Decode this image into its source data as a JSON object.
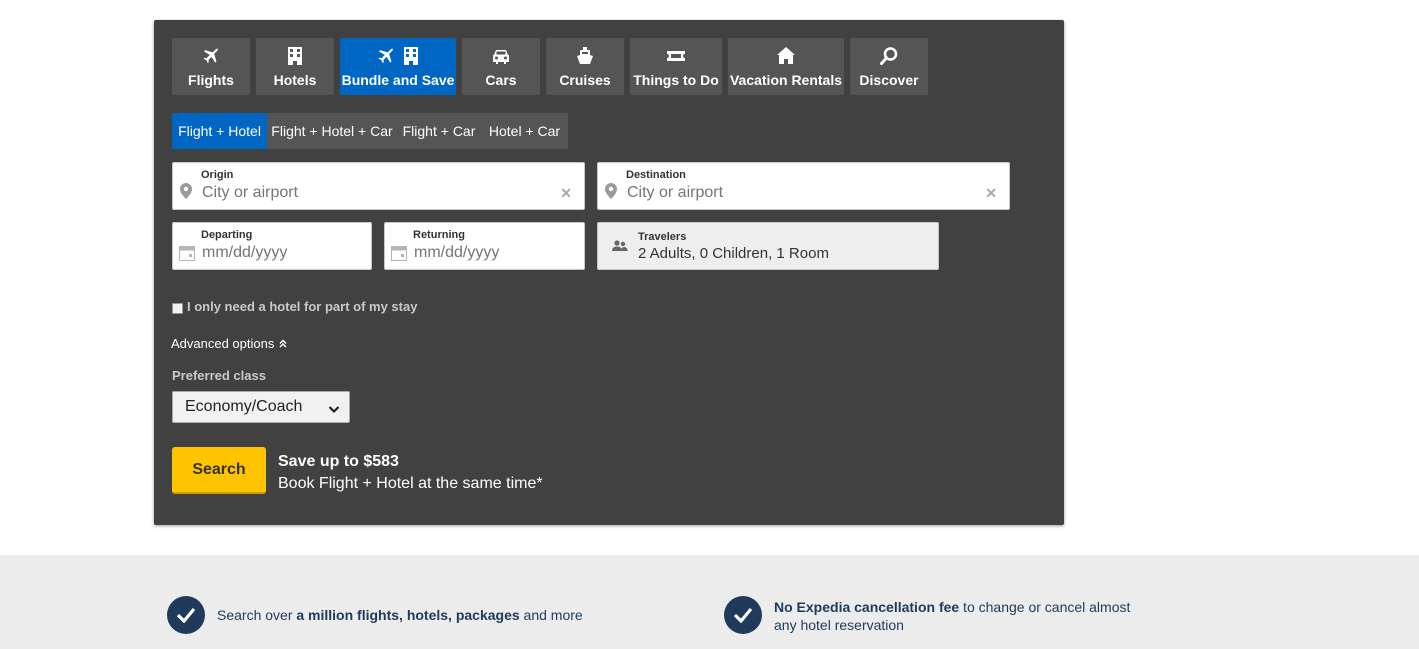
{
  "tabs": [
    {
      "label": "Flights",
      "icon": "plane-icon"
    },
    {
      "label": "Hotels",
      "icon": "building-icon"
    },
    {
      "label": "Bundle and Save",
      "icon": "plane-building-icon"
    },
    {
      "label": "Cars",
      "icon": "car-icon"
    },
    {
      "label": "Cruises",
      "icon": "ship-icon"
    },
    {
      "label": "Things to Do",
      "icon": "ticket-icon"
    },
    {
      "label": "Vacation Rentals",
      "icon": "house-icon"
    },
    {
      "label": "Discover",
      "icon": "magnifier-icon"
    }
  ],
  "active_tab": "Bundle and Save",
  "subtabs": [
    "Flight + Hotel",
    "Flight + Hotel + Car",
    "Flight + Car",
    "Hotel + Car"
  ],
  "active_subtab": "Flight + Hotel",
  "origin": {
    "label": "Origin",
    "placeholder": "City or airport"
  },
  "destination": {
    "label": "Destination",
    "placeholder": "City or airport"
  },
  "departing": {
    "label": "Departing",
    "placeholder": "mm/dd/yyyy"
  },
  "returning": {
    "label": "Returning",
    "placeholder": "mm/dd/yyyy"
  },
  "travelers": {
    "label": "Travelers",
    "value": "2 Adults, 0 Children, 1 Room"
  },
  "partial_stay_label": "I only need a hotel for part of my stay",
  "advanced_options_label": "Advanced options",
  "preferred_class": {
    "label": "Preferred class",
    "value": "Economy/Coach"
  },
  "search_label": "Search",
  "savings": {
    "headline": "Save up to $583",
    "sub": "Book Flight + Hotel at the same time*"
  },
  "features": [
    {
      "pre": "Search over ",
      "bold": "a million flights, hotels, packages",
      "post": " and more"
    },
    {
      "pre": "",
      "bold": "No Expedia cancellation fee",
      "post": " to change or cancel almost any hotel reservation"
    }
  ],
  "colors": {
    "panel": "#414141",
    "tab": "#555555",
    "active": "#0066c4",
    "search": "#fec400",
    "navy": "#1f3a5a"
  }
}
